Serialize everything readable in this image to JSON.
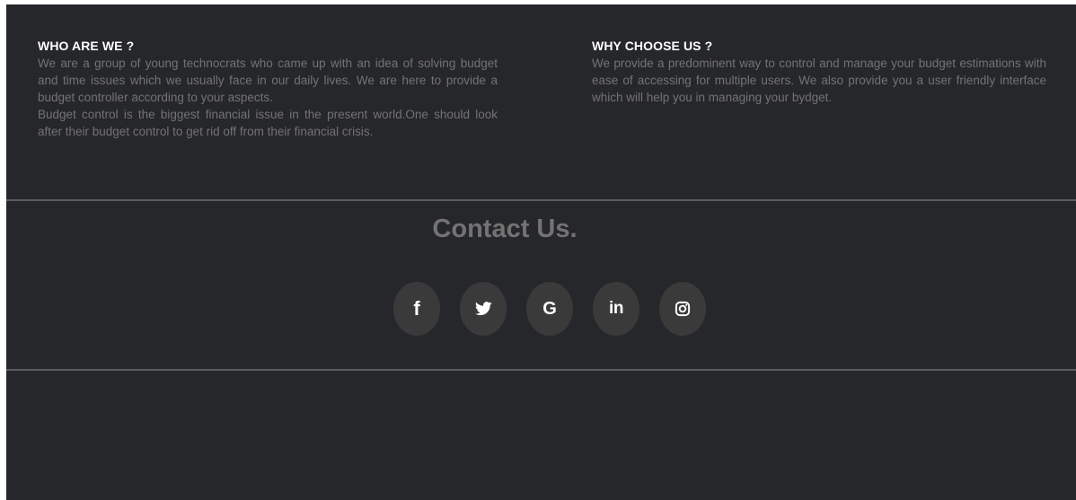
{
  "about": {
    "title": "WHO ARE WE ?",
    "text_1": "We are a group of young technocrats who came up with an idea of solving budget and time issues which we usually face in our daily lives. We are here to provide a budget controller according to your aspects.",
    "text_2": "Budget control is the biggest financial issue in the present world.One should look after their budget control to get rid off from their financial crisis."
  },
  "why": {
    "title": "WHY CHOOSE US ?",
    "text": "We provide a predominent way to control and manage your budget estimations with ease of accessing for multiple users. We also provide you a user friendly interface which will help you in managing your bydget."
  },
  "contact": {
    "title": "Contact Us.",
    "social": [
      {
        "icon": "facebook-icon",
        "glyph": "f"
      },
      {
        "icon": "twitter-icon",
        "glyph": ""
      },
      {
        "icon": "google-icon",
        "glyph": "G"
      },
      {
        "icon": "linkedin-icon",
        "glyph": "in"
      },
      {
        "icon": "instagram-icon",
        "glyph": ""
      }
    ]
  },
  "colors": {
    "background": "#26272b",
    "heading": "#ffffff",
    "body_text": "#737373",
    "divider": "#5b5c60",
    "social_bg": "#3a3a3b"
  }
}
